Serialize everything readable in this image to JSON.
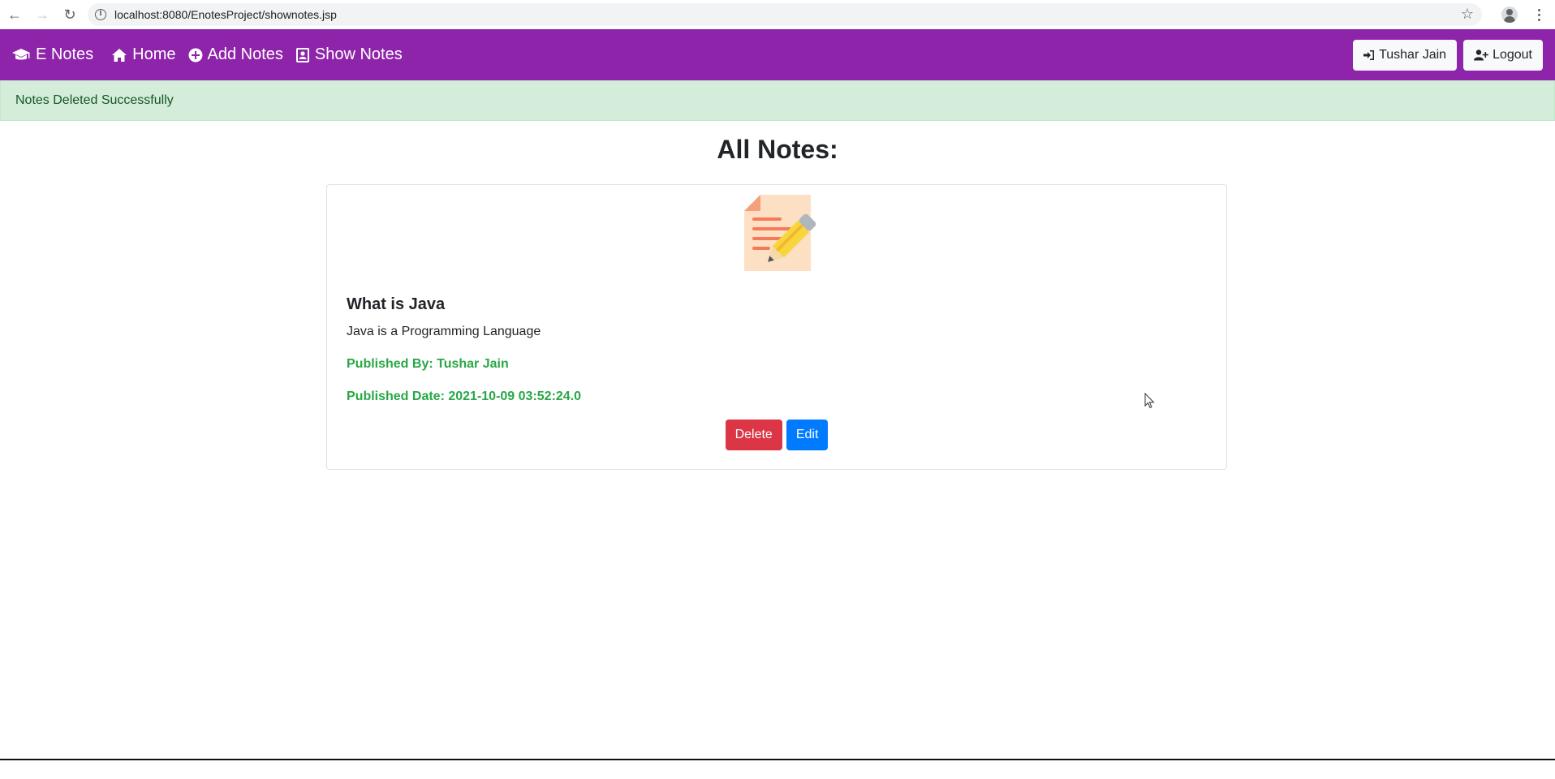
{
  "browser": {
    "url": "localhost:8080/EnotesProject/shownotes.jsp"
  },
  "navbar": {
    "brand": "E Notes",
    "items": [
      {
        "label": "Home",
        "icon": "home-icon"
      },
      {
        "label": "Add Notes",
        "icon": "plus-circle-icon"
      },
      {
        "label": "Show Notes",
        "icon": "address-book-icon"
      }
    ],
    "user_label": "Tushar Jain",
    "logout_label": "Logout",
    "color": "#8e24aa"
  },
  "alert": {
    "message": "Notes Deleted Successfully"
  },
  "page": {
    "title": "All Notes:"
  },
  "note": {
    "title": "What is Java",
    "content": "Java is a Programming Language",
    "published_by": "Published By: Tushar Jain",
    "published_date": "Published Date: 2021-10-09 03:52:24.0",
    "delete_label": "Delete",
    "edit_label": "Edit"
  }
}
